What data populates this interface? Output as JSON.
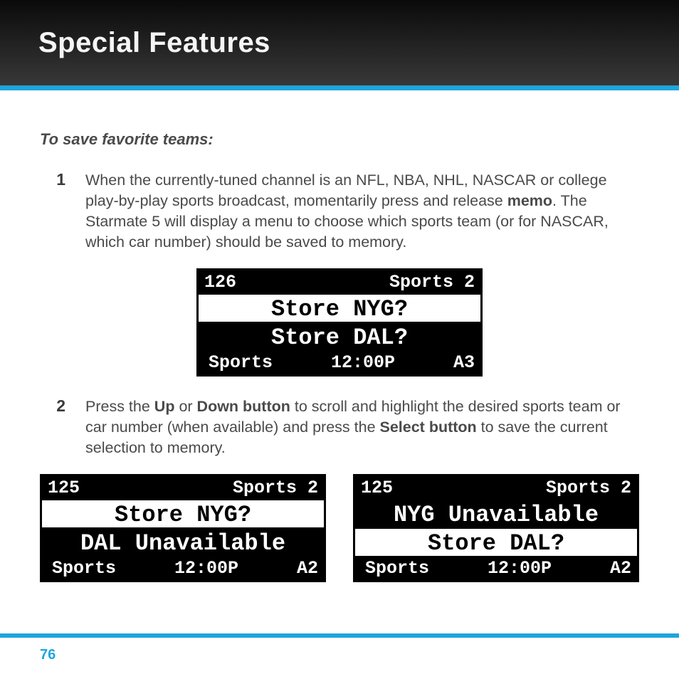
{
  "header": {
    "title": "Special Features"
  },
  "subhead": "To save favorite teams:",
  "steps": [
    {
      "num": "1",
      "parts": [
        "When the currently-tuned channel is an NFL, NBA, NHL, NASCAR or college play-by-play sports broadcast, momentarily press and release ",
        "memo",
        ". The Starmate 5 will display a menu to choose which sports team (or for NASCAR, which car number) should be saved to memory."
      ]
    },
    {
      "num": "2",
      "parts": [
        "Press the ",
        "Up",
        " or ",
        "Down button",
        " to scroll and highlight the desired sports team or car number (when available) and press the ",
        "Select button",
        " to save the current selection to memory."
      ]
    }
  ],
  "lcd_main": {
    "top_left": "126",
    "top_right": "Sports 2",
    "line1": "Store NYG?",
    "line2": "Store DAL?",
    "line2_hl": true,
    "bot_left": "Sports",
    "bot_mid": "12:00P",
    "bot_right": "A3"
  },
  "lcd_left": {
    "top_left": "125",
    "top_right": "Sports 2",
    "line1": "Store NYG?",
    "line2": "DAL Unavailable",
    "line2_hl": true,
    "bot_left": "Sports",
    "bot_mid": "12:00P",
    "bot_right": "A2"
  },
  "lcd_right": {
    "top_left": "125",
    "top_right": "Sports 2",
    "line1": "NYG Unavailable",
    "line1_hl": true,
    "line2": "Store DAL?",
    "bot_left": "Sports",
    "bot_mid": "12:00P",
    "bot_right": "A2"
  },
  "page_number": "76"
}
